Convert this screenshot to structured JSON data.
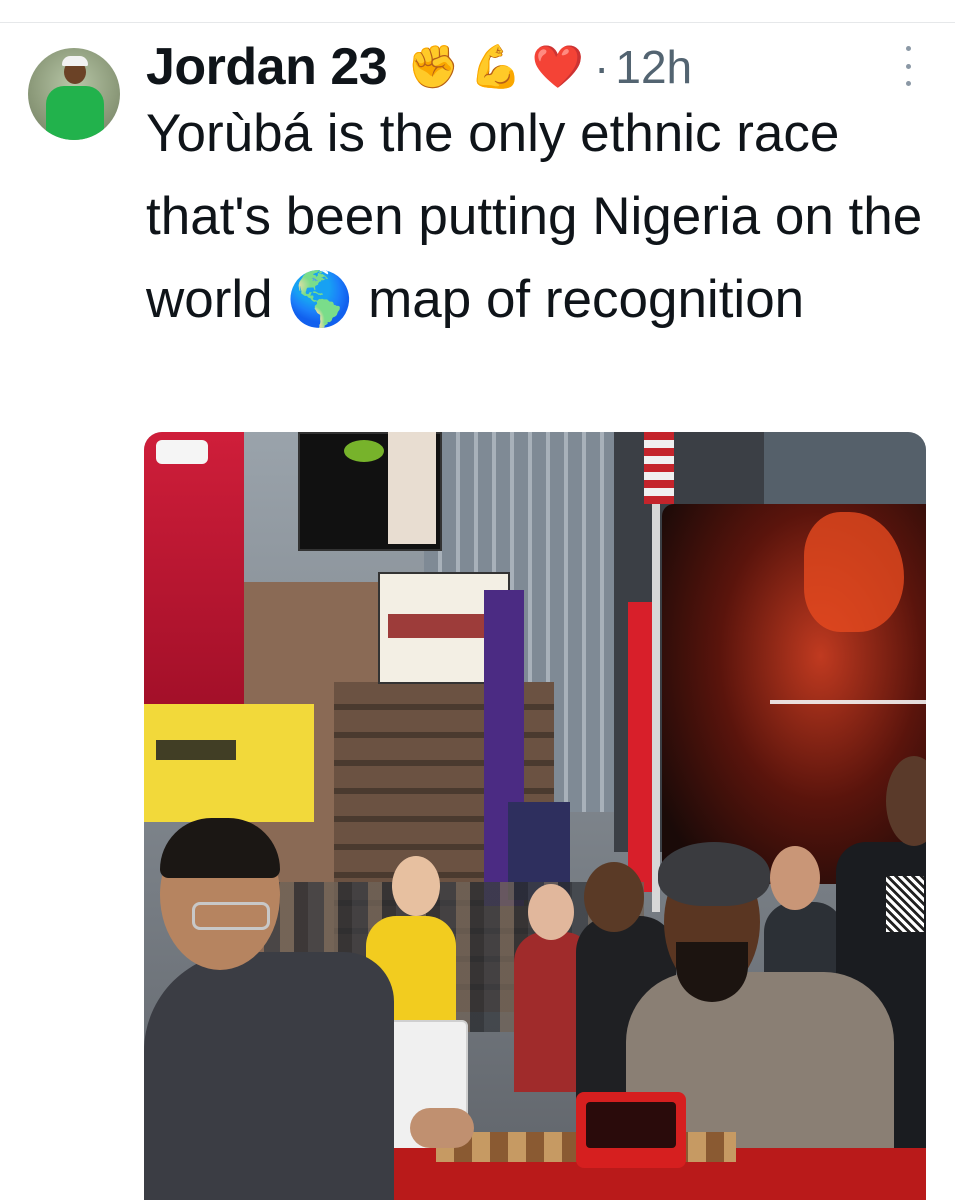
{
  "tweet": {
    "author": {
      "display_name": "Jordan 23",
      "avatar_icon": "user-avatar"
    },
    "badges": [
      {
        "emoji": "✊",
        "name": "fist-emoji-icon"
      },
      {
        "emoji": "💪",
        "name": "flexed-biceps-emoji-icon"
      },
      {
        "emoji": "❤️",
        "name": "red-heart-emoji-icon"
      }
    ],
    "separator": "·",
    "timestamp": "12h",
    "text": "Yorùbá is the only ethnic race that's been putting Nigeria on the world",
    "text_emoji": "🌎",
    "text_end": "map of recognition",
    "more_icon": "more-options-icon"
  }
}
